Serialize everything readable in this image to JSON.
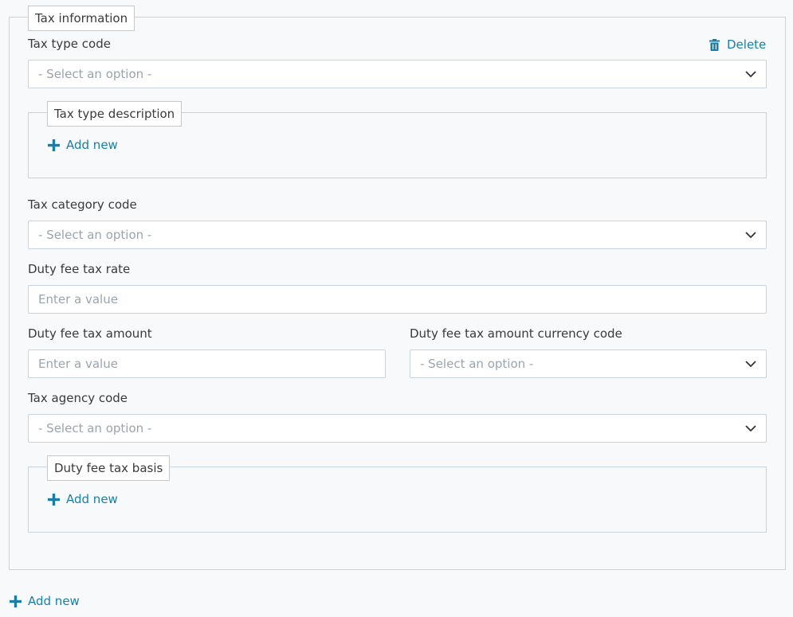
{
  "tax_info": {
    "legend": "Tax information",
    "delete_label": "Delete",
    "tax_type_code": {
      "label": "Tax type code",
      "placeholder": "- Select an option -"
    },
    "tax_type_description": {
      "legend": "Tax type description",
      "add_label": "Add new"
    },
    "tax_category_code": {
      "label": "Tax category code",
      "placeholder": "- Select an option -"
    },
    "duty_fee_tax_rate": {
      "label": "Duty fee tax rate",
      "placeholder": "Enter a value"
    },
    "duty_fee_tax_amount": {
      "label": "Duty fee tax amount",
      "placeholder": "Enter a value"
    },
    "duty_fee_tax_amount_currency_code": {
      "label": "Duty fee tax amount currency code",
      "placeholder": "- Select an option -"
    },
    "tax_agency_code": {
      "label": "Tax agency code",
      "placeholder": "- Select an option -"
    },
    "duty_fee_tax_basis": {
      "legend": "Duty fee tax basis",
      "add_label": "Add new"
    }
  },
  "outer_add_label": "Add new",
  "colors": {
    "accent": "#1b7ea6",
    "border": "#c5d4e0",
    "placeholder": "#9aa4ad",
    "background": "#f7f9fb"
  },
  "icons": {
    "delete": "trash-icon",
    "add": "plus-icon",
    "dropdown": "chevron-down-icon"
  }
}
